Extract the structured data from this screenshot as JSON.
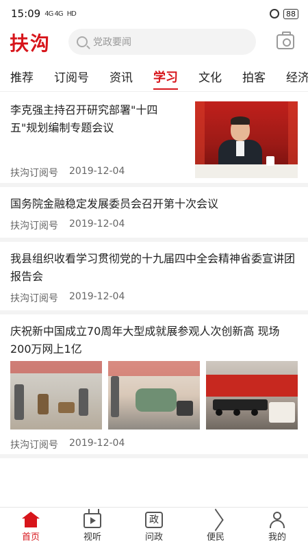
{
  "status_bar": {
    "time": "15:09",
    "signal_text": "4G 4G",
    "network": "HD",
    "battery": "88"
  },
  "header": {
    "logo": "扶沟",
    "search_placeholder": "党政要闻",
    "icons": {
      "search": "search-icon",
      "camera": "camera-icon"
    }
  },
  "tabs": [
    {
      "label": "推荐"
    },
    {
      "label": "订阅号"
    },
    {
      "label": "资讯"
    },
    {
      "label": "学习"
    },
    {
      "label": "文化"
    },
    {
      "label": "拍客"
    },
    {
      "label": "经济"
    }
  ],
  "active_tab": "学习",
  "articles": [
    {
      "title": "李克强主持召开研究部署\"十四五\"规划编制专题会议",
      "source": "扶沟订阅号",
      "date": "2019-12-04"
    },
    {
      "title": "国务院金融稳定发展委员会召开第十次会议",
      "source": "扶沟订阅号",
      "date": "2019-12-04"
    },
    {
      "title": "我县组织收看学习贯彻党的十九届四中全会精神省委宣讲团报告会",
      "source": "扶沟订阅号",
      "date": "2019-12-04"
    },
    {
      "title": "庆祝新中国成立70周年大型成就展参观人次创新高 现场200万网上1亿",
      "source": "扶沟订阅号",
      "date": "2019-12-04"
    }
  ],
  "bottom_nav": [
    {
      "label": "首页",
      "icon": "home-icon"
    },
    {
      "label": "视听",
      "icon": "tv-icon"
    },
    {
      "label": "问政",
      "icon": "zheng-icon",
      "glyph": "政"
    },
    {
      "label": "便民",
      "icon": "send-icon"
    },
    {
      "label": "我的",
      "icon": "user-icon"
    }
  ],
  "colors": {
    "accent": "#d7151b",
    "divider": "#f3f3f3"
  }
}
